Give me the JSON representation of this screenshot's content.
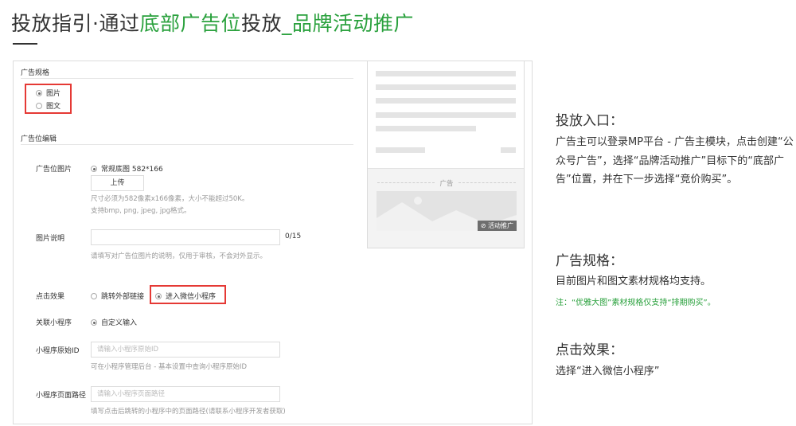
{
  "page": {
    "title_prefix": "投放指引·通过",
    "title_green_1": "底部广告位",
    "title_mid": "投放",
    "title_green_2": "_品牌活动推广"
  },
  "form": {
    "spec_section": "广告规格",
    "spec_options": [
      "图片",
      "图文"
    ],
    "spec_selected": "图片",
    "edit_section": "广告位编辑",
    "ad_image_label": "广告位图片",
    "ad_image_option": "常规底图 582*166",
    "upload_button": "上传",
    "image_hint_1": "尺寸必须为582像素x166像素，大小不能超过50K。",
    "image_hint_2": "支持bmp, png, jpeg, jpg格式。",
    "desc_label": "图片说明",
    "desc_counter": "0/15",
    "desc_hint": "请填写对广告位图片的说明，仅用于审核，不会对外显示。",
    "click_label": "点击效果",
    "click_options": [
      "跳转外部链接",
      "进入微信小程序"
    ],
    "click_selected": "进入微信小程序",
    "mini_label": "关联小程序",
    "mini_option": "自定义输入",
    "mini_id_label": "小程序原始ID",
    "mini_id_placeholder": "请输入小程序原始ID",
    "mini_id_hint": "可在小程序管理后台 - 基本设置中查询小程序原始ID",
    "mini_path_label": "小程序页面路径",
    "mini_path_placeholder": "请输入小程序页面路径",
    "mini_path_hint": "填写点击后跳转的小程序中的页面路径(请联系小程序开发者获取)"
  },
  "preview": {
    "ad_label": "广告",
    "ad_tag": "活动推广",
    "link_icon": "link-icon"
  },
  "guide": {
    "entry_title": "投放入口：",
    "entry_text": "广告主可以登录MP平台 - 广告主模块，点击创建“公众号广告”，选择“品牌活动推广”目标下的“底部广告”位置，并在下一步选择“竞价购买”。",
    "spec_title": "广告规格：",
    "spec_text": "目前图片和图文素材规格均支持。",
    "spec_note": "注：“优雅大图”素材规格仅支持“排期购买”。",
    "click_title": "点击效果：",
    "click_text": "选择“进入微信小程序”"
  },
  "colors": {
    "accent_green": "#2aa13d",
    "highlight_red": "#e53935"
  }
}
